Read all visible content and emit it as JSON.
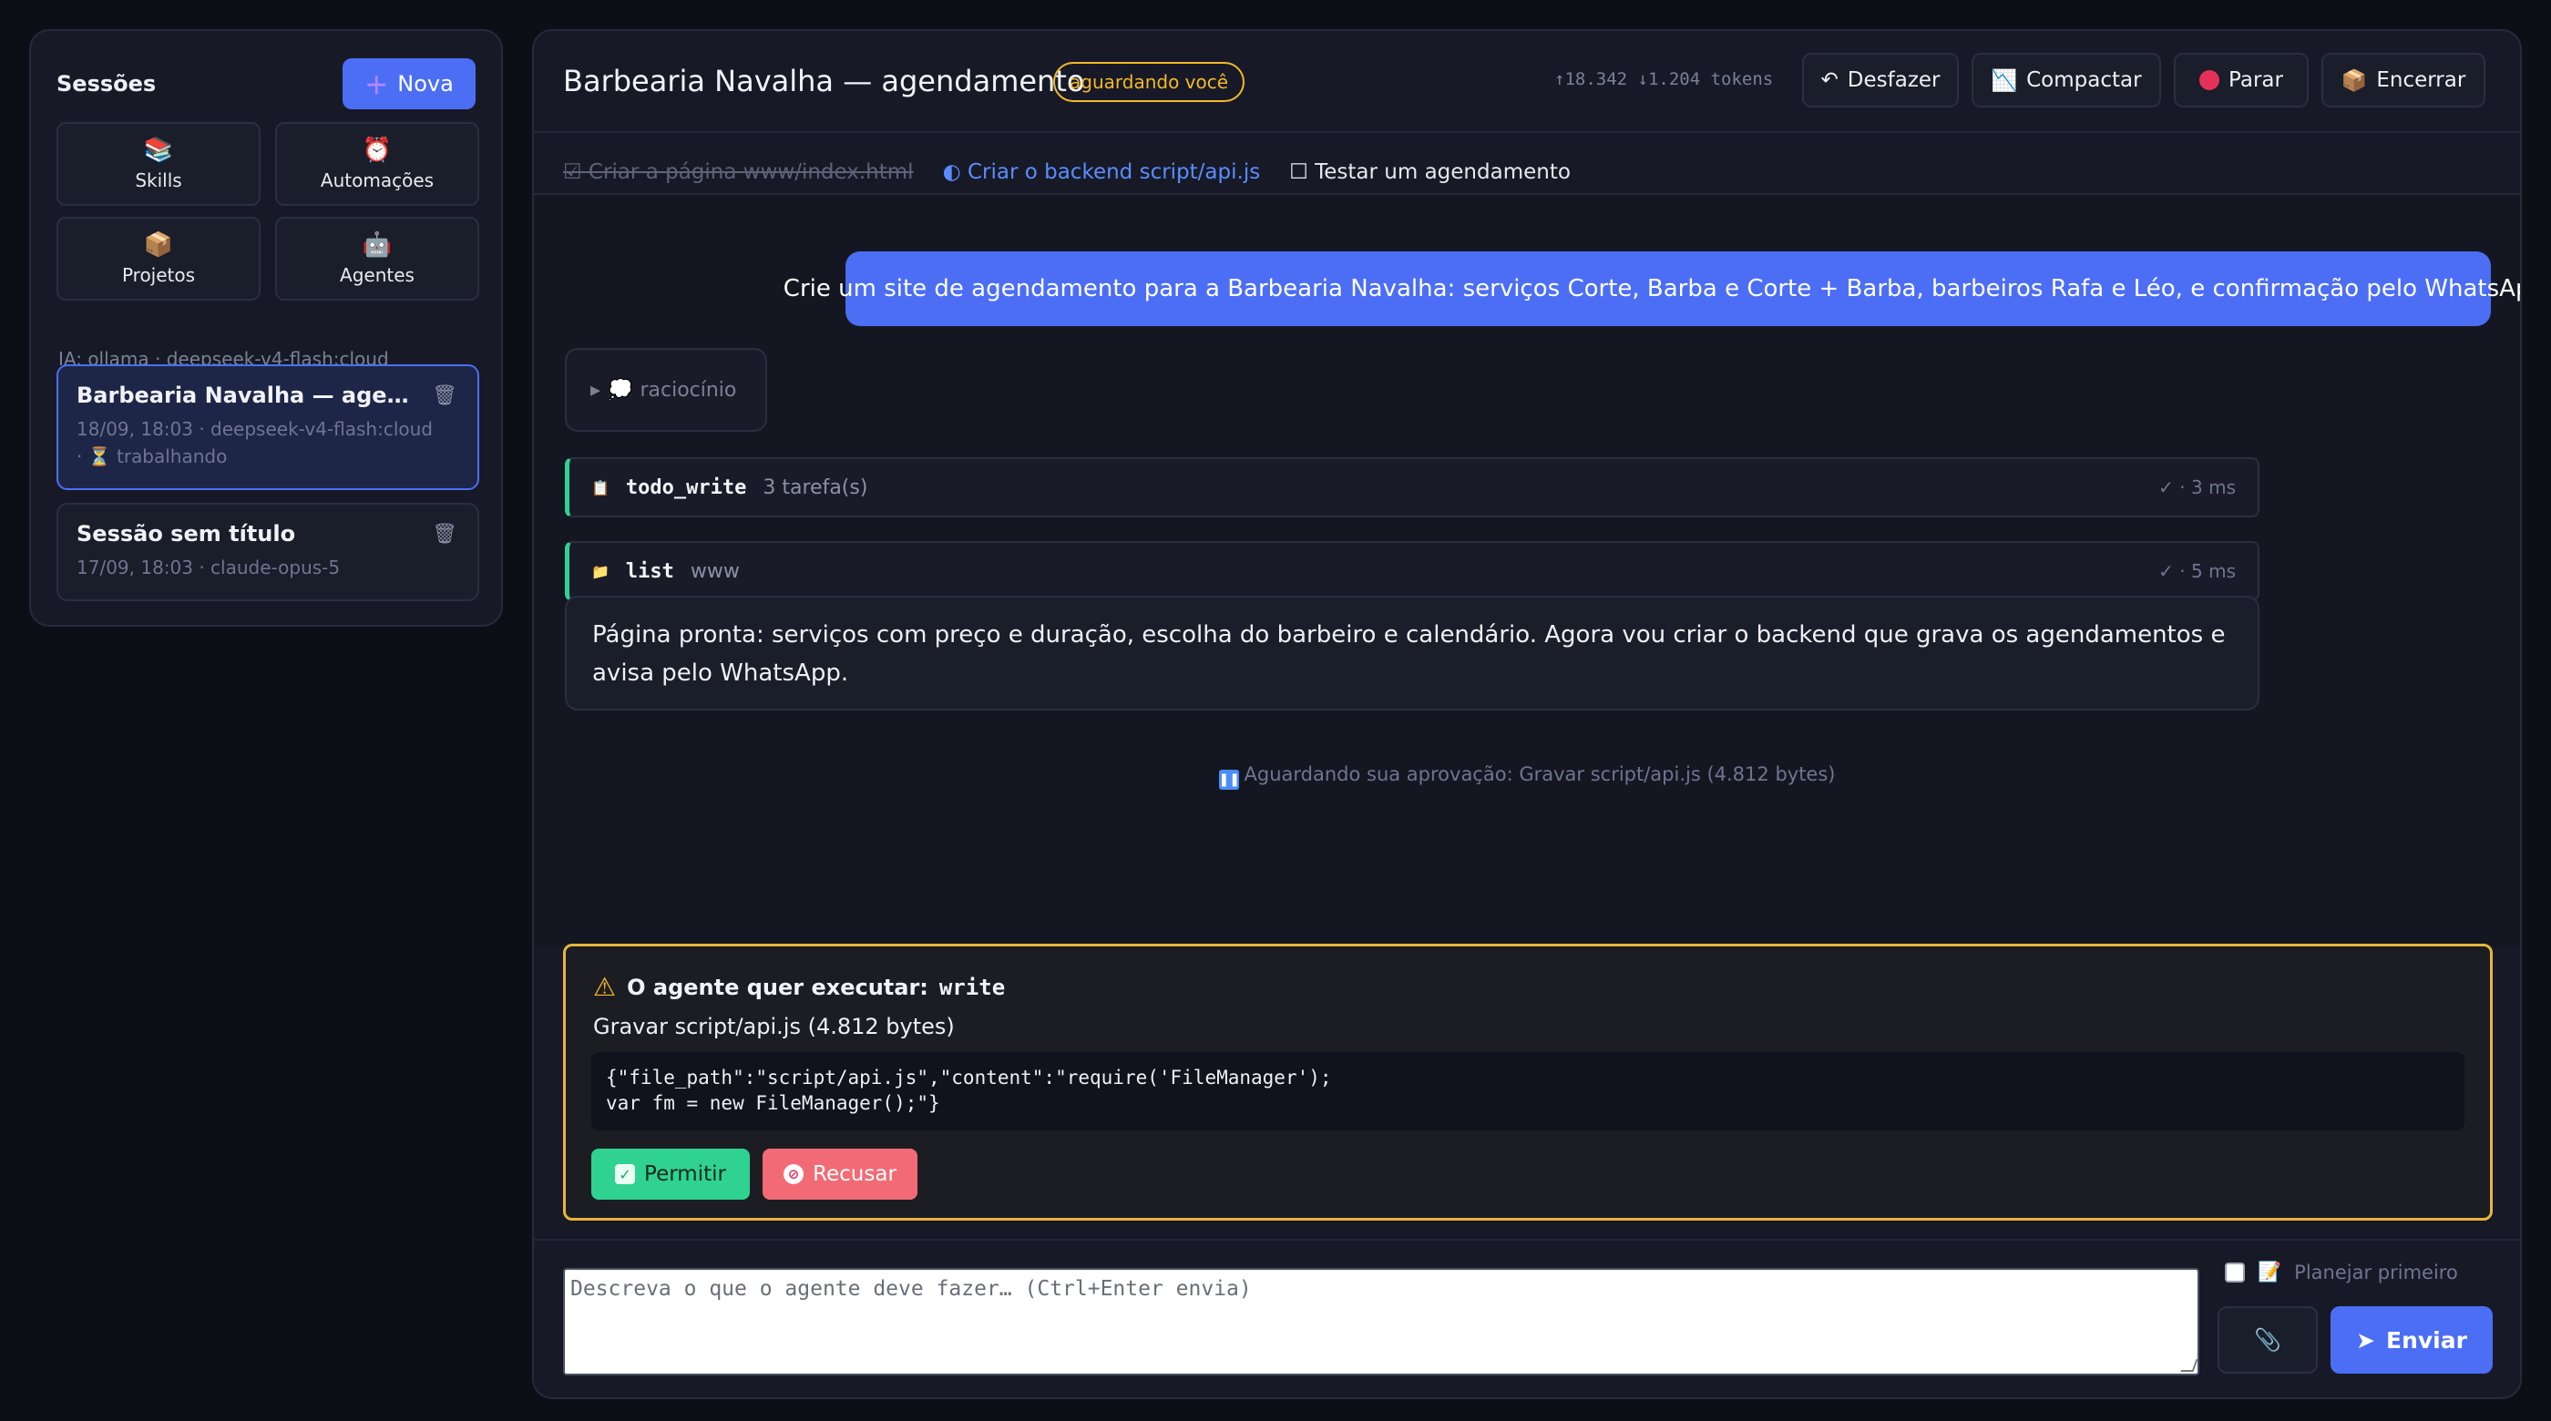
{
  "sidebar": {
    "title": "Sessões",
    "new_label": "Nova",
    "tiles": [
      {
        "label": "Skills",
        "icon": "books-icon"
      },
      {
        "label": "Automações",
        "icon": "alarm-clock-icon"
      },
      {
        "label": "Projetos",
        "icon": "package-icon"
      },
      {
        "label": "Agentes",
        "icon": "robot-icon"
      }
    ],
    "ai_line": "IA: ollama · deepseek-v4-flash:cloud",
    "sessions": [
      {
        "title": "Barbearia Navalha — agenda...",
        "meta1": "18/09, 18:03 · deepseek-v4-flash:cloud",
        "meta2": "· ⏳ trabalhando",
        "active": true
      },
      {
        "title": "Sessão sem título",
        "meta1": "17/09, 18:03 · claude-opus-5",
        "active": false
      }
    ]
  },
  "header": {
    "title": "Barbearia Navalha — agendamento",
    "status_badge": "aguardando você",
    "tokens": "↑18.342 ↓1.204 tokens",
    "buttons": {
      "undo": "Desfazer",
      "compact": "Compactar",
      "stop": "Parar",
      "end": "Encerrar"
    }
  },
  "todos": [
    {
      "text": "☑ Criar a página www/index.html",
      "state": "done"
    },
    {
      "text": "◐ Criar o backend script/api.js",
      "state": "in_progress"
    },
    {
      "text": "☐ Testar um agendamento",
      "state": "pending"
    }
  ],
  "chat": {
    "user_message": "Crie um site de agendamento para a Barbearia Navalha: serviços Corte, Barba e Corte + Barba, barbeiros Rafa e Léo, e confirmação pelo WhatsApp.",
    "reasoning_label": "raciocínio",
    "tools": [
      {
        "name": "todo_write",
        "arg": "3 tarefa(s)",
        "time": "✓ · 3 ms",
        "icon": "clipboard-icon"
      },
      {
        "name": "list",
        "arg": "www",
        "time": "✓ · 5 ms",
        "icon": "folder-icon"
      }
    ],
    "assistant_message": "Página pronta: serviços com preço e duração, escolha do barbeiro e calendário. Agora vou criar o backend que grava os agendamentos e avisa pelo WhatsApp.",
    "awaiting": "Aguardando sua aprovação: Gravar script/api.js (4.812 bytes)"
  },
  "approval": {
    "title_prefix": "O agente quer executar:",
    "tool": "write",
    "description": "Gravar script/api.js (4.812 bytes)",
    "code": "{\"file_path\":\"script/api.js\",\"content\":\"require('FileManager');\nvar fm = new FileManager();\"}",
    "allow_label": "Permitir",
    "refuse_label": "Recusar"
  },
  "composer": {
    "placeholder": "Descreva o que o agente deve fazer… (Ctrl+Enter envia)",
    "plan_label": "Planejar primeiro",
    "send_label": "Enviar"
  },
  "colors": {
    "accent": "#4c6ef5",
    "success": "#2fd291",
    "danger": "#f26b74",
    "warning": "#f5b82e"
  }
}
